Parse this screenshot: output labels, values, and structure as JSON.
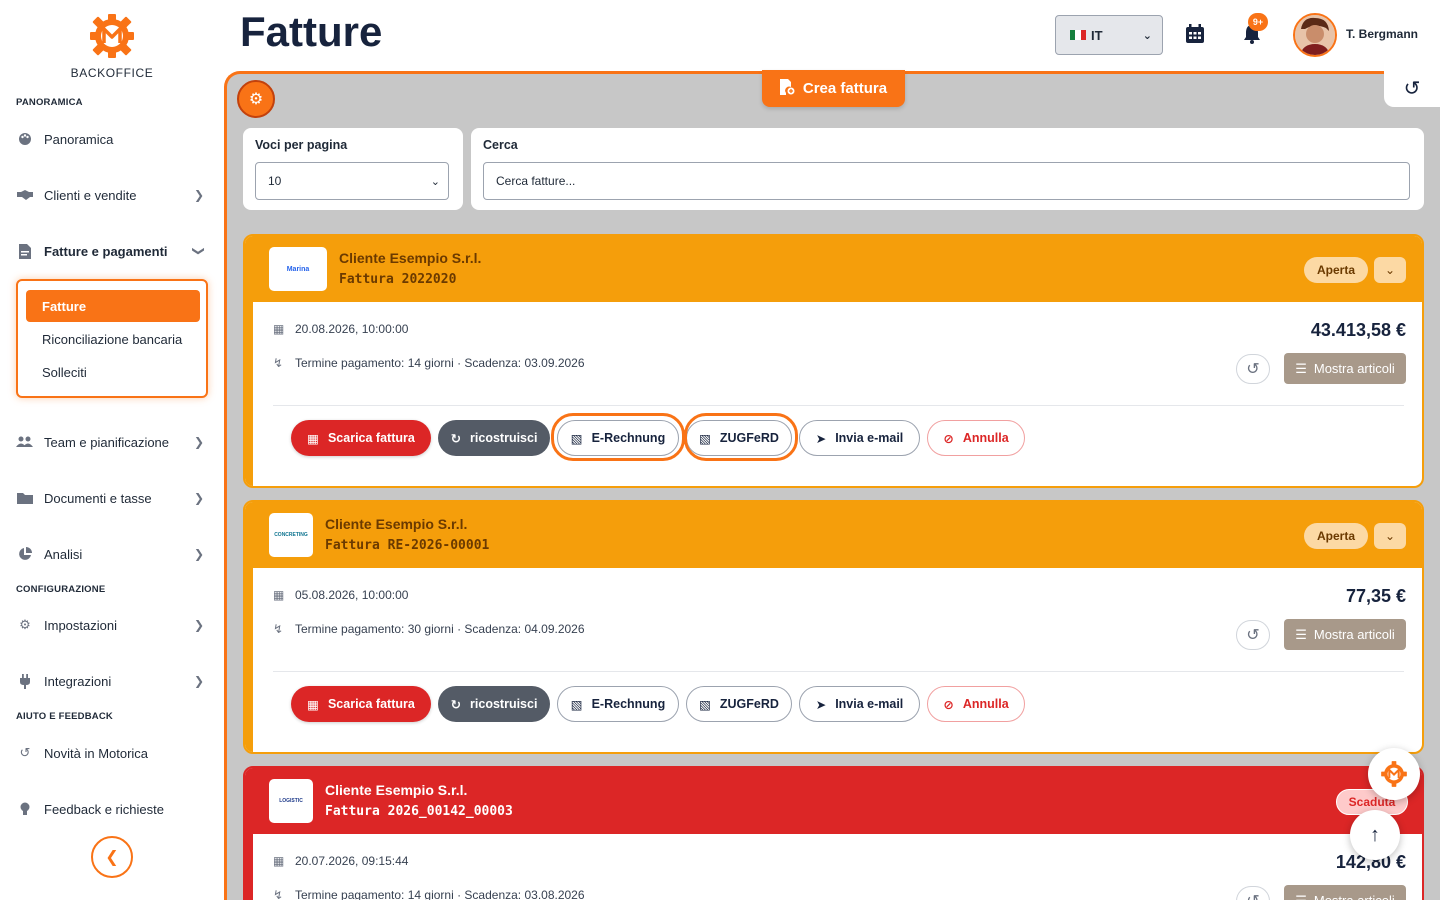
{
  "app": {
    "brand": "BACKOFFICE",
    "page_title": "Fatture"
  },
  "header": {
    "language": "IT",
    "notifications_badge": "9+",
    "user_name": "T. Bergmann"
  },
  "sidebar": {
    "sections": {
      "overview": "PANORAMICA",
      "config": "CONFIGURAZIONE",
      "help": "AIUTO E FEEDBACK"
    },
    "items": {
      "overview": "Panoramica",
      "clients": "Clienti e vendite",
      "invoices_payments": "Fatture e pagamenti",
      "team": "Team e pianificazione",
      "documents": "Documenti e tasse",
      "analytics": "Analisi",
      "settings": "Impostazioni",
      "integrations": "Integrazioni",
      "news": "Novità in Motorica",
      "feedback": "Feedback e richieste"
    },
    "subitems": {
      "invoices": "Fatture",
      "bank_reconciliation": "Riconciliazione bancaria",
      "reminders": "Solleciti"
    }
  },
  "toolbar": {
    "create_label": "Crea fattura"
  },
  "filters": {
    "per_page_label": "Voci per pagina",
    "per_page_value": "10",
    "search_label": "Cerca",
    "search_placeholder": "Cerca fatture..."
  },
  "actions": {
    "download": "Scarica fattura",
    "rebuild": "ricostruisci",
    "erechnung": "E-Rechnung",
    "zugferd": "ZUGFeRD",
    "email": "Invia e-mail",
    "cancel": "Annulla",
    "show_items": "Mostra articoli"
  },
  "invoices": [
    {
      "client": "Cliente Esempio S.r.l.",
      "number": "Fattura 2022020",
      "status": "Aperta",
      "date": "20.08.2026, 10:00:00",
      "terms": "Termine pagamento: 14 giorni · Scadenza: 03.09.2026",
      "amount": "43.413,58 €",
      "logo_text": "Marina"
    },
    {
      "client": "Cliente Esempio S.r.l.",
      "number": "Fattura RE-2026-00001",
      "status": "Aperta",
      "date": "05.08.2026, 10:00:00",
      "terms": "Termine pagamento: 30 giorni · Scadenza: 04.09.2026",
      "amount": "77,35 €",
      "logo_text": "CONCRETING"
    },
    {
      "client": "Cliente Esempio S.r.l.",
      "number": "Fattura 2026_00142_00003",
      "status": "Scaduta",
      "date": "20.07.2026, 09:15:44",
      "terms": "Termine pagamento: 14 giorni · Scadenza: 03.08.2026",
      "amount": "142,80 €",
      "logo_text": "LOGISTIC"
    }
  ],
  "colors": {
    "accent": "#f97316",
    "open": "#f59e0b",
    "overdue": "#dc2626",
    "navy": "#17233d"
  }
}
